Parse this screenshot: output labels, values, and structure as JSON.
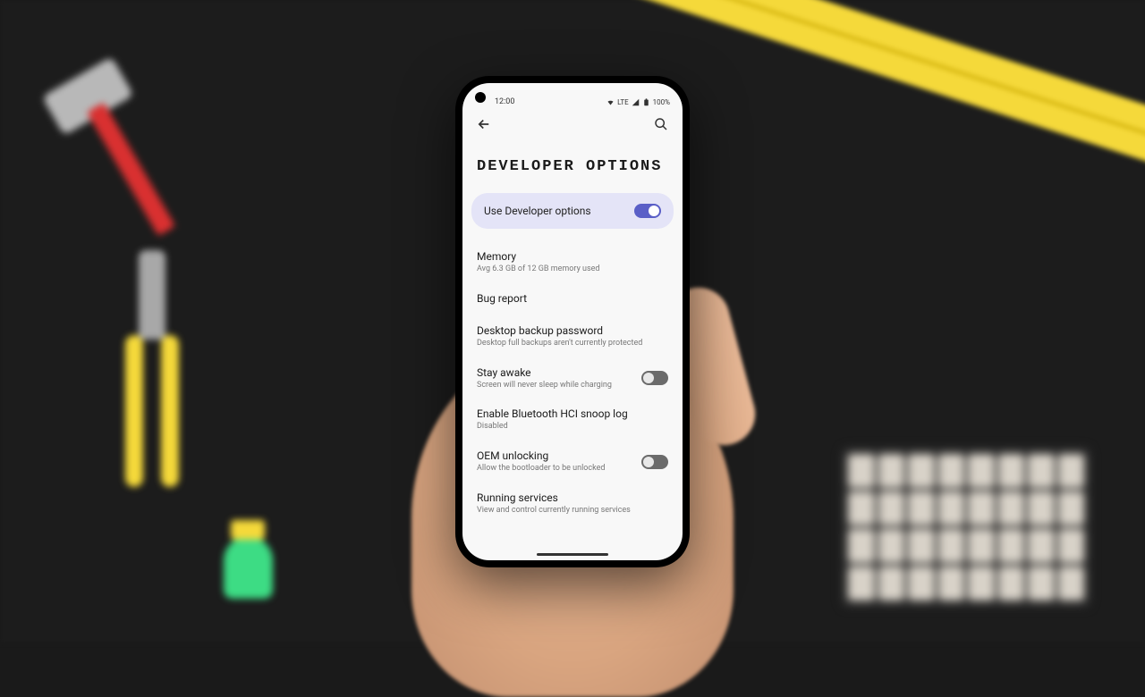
{
  "status": {
    "time": "12:00",
    "network": "LTE",
    "battery": "100%"
  },
  "page": {
    "title": "DEVELOPER OPTIONS"
  },
  "master": {
    "label": "Use Developer options",
    "enabled": true
  },
  "settings": [
    {
      "title": "Memory",
      "subtitle": "Avg 6.3 GB of 12 GB memory used",
      "toggle": null
    },
    {
      "title": "Bug report",
      "subtitle": "",
      "toggle": null
    },
    {
      "title": "Desktop backup password",
      "subtitle": "Desktop full backups aren't currently protected",
      "toggle": null
    },
    {
      "title": "Stay awake",
      "subtitle": "Screen will never sleep while charging",
      "toggle": false
    },
    {
      "title": "Enable Bluetooth HCI snoop log",
      "subtitle": "Disabled",
      "toggle": null
    },
    {
      "title": "OEM unlocking",
      "subtitle": "Allow the bootloader to be unlocked",
      "toggle": false
    },
    {
      "title": "Running services",
      "subtitle": "View and control currently running services",
      "toggle": null
    }
  ]
}
